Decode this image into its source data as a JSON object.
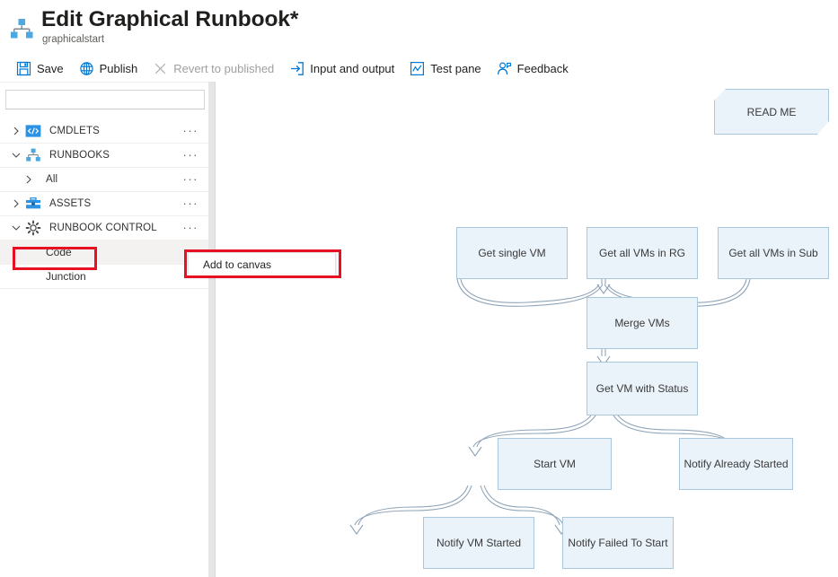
{
  "header": {
    "title": "Edit Graphical Runbook*",
    "subtitle": "graphicalstart",
    "more_label": "···",
    "icon": "runbook-hierarchy-icon"
  },
  "commandbar": {
    "items": [
      {
        "label": "Save",
        "icon": "save-icon",
        "disabled": false
      },
      {
        "label": "Publish",
        "icon": "globe-icon",
        "disabled": false
      },
      {
        "label": "Revert to published",
        "icon": "close-x-icon",
        "disabled": true
      },
      {
        "label": "Input and output",
        "icon": "input-output-icon",
        "disabled": false
      },
      {
        "label": "Test pane",
        "icon": "test-chart-icon",
        "disabled": false
      },
      {
        "label": "Feedback",
        "icon": "feedback-person-icon",
        "disabled": false
      }
    ]
  },
  "sidebar": {
    "search": {
      "value": "",
      "placeholder": ""
    },
    "tree": [
      {
        "label": "CMDLETS",
        "icon": "code-brackets-icon",
        "state": "collapsed",
        "indent": 0,
        "ellipsis": true,
        "hovered": false
      },
      {
        "label": "RUNBOOKS",
        "icon": "hierarchy-icon",
        "state": "expanded",
        "indent": 0,
        "ellipsis": true,
        "hovered": false
      },
      {
        "label": "All",
        "icon": "none",
        "state": "collapsed",
        "indent": 1,
        "ellipsis": true,
        "hovered": false
      },
      {
        "label": "ASSETS",
        "icon": "briefcase-icon",
        "state": "collapsed",
        "indent": 0,
        "ellipsis": true,
        "hovered": false
      },
      {
        "label": "RUNBOOK CONTROL",
        "icon": "gear-icon",
        "state": "expanded",
        "indent": 0,
        "ellipsis": true,
        "hovered": false
      },
      {
        "label": "Code",
        "icon": "none",
        "state": "leaf",
        "indent": 1,
        "ellipsis": false,
        "hovered": true
      },
      {
        "label": "Junction",
        "icon": "none",
        "state": "leaf",
        "indent": 1,
        "ellipsis": true,
        "hovered": false
      }
    ]
  },
  "context_menu": {
    "items": [
      {
        "label": "Add to canvas"
      }
    ]
  },
  "annotations": {
    "highlight_color": "#e81123",
    "boxes": [
      {
        "target": "Code"
      },
      {
        "target": "Add to canvas"
      }
    ]
  },
  "canvas": {
    "note": {
      "label": "READ ME"
    },
    "nodes": [
      {
        "id": "get-single-vm",
        "label": "Get single VM"
      },
      {
        "id": "get-all-vms-in-rg",
        "label": "Get all VMs in RG"
      },
      {
        "id": "get-all-vms-in-sub",
        "label": "Get all VMs in Sub"
      },
      {
        "id": "merge-vms",
        "label": "Merge VMs"
      },
      {
        "id": "get-vm-with-status",
        "label": "Get VM with Status"
      },
      {
        "id": "start-vm",
        "label": "Start VM"
      },
      {
        "id": "notify-already-started",
        "label": "Notify Already Started"
      },
      {
        "id": "notify-vm-started",
        "label": "Notify VM Started"
      },
      {
        "id": "notify-failed-to-start",
        "label": "Notify Failed To Start"
      }
    ],
    "edges": [
      {
        "from": "get-single-vm",
        "to": "merge-vms"
      },
      {
        "from": "get-all-vms-in-rg",
        "to": "merge-vms"
      },
      {
        "from": "get-all-vms-in-sub",
        "to": "merge-vms"
      },
      {
        "from": "merge-vms",
        "to": "get-vm-with-status"
      },
      {
        "from": "get-vm-with-status",
        "to": "start-vm"
      },
      {
        "from": "get-vm-with-status",
        "to": "notify-already-started"
      },
      {
        "from": "start-vm",
        "to": "notify-vm-started"
      },
      {
        "from": "start-vm",
        "to": "notify-failed-to-start"
      }
    ],
    "node_fill": "#eaf3fa",
    "node_border": "#a9c6da",
    "edge_color": "#8fa4b8"
  }
}
